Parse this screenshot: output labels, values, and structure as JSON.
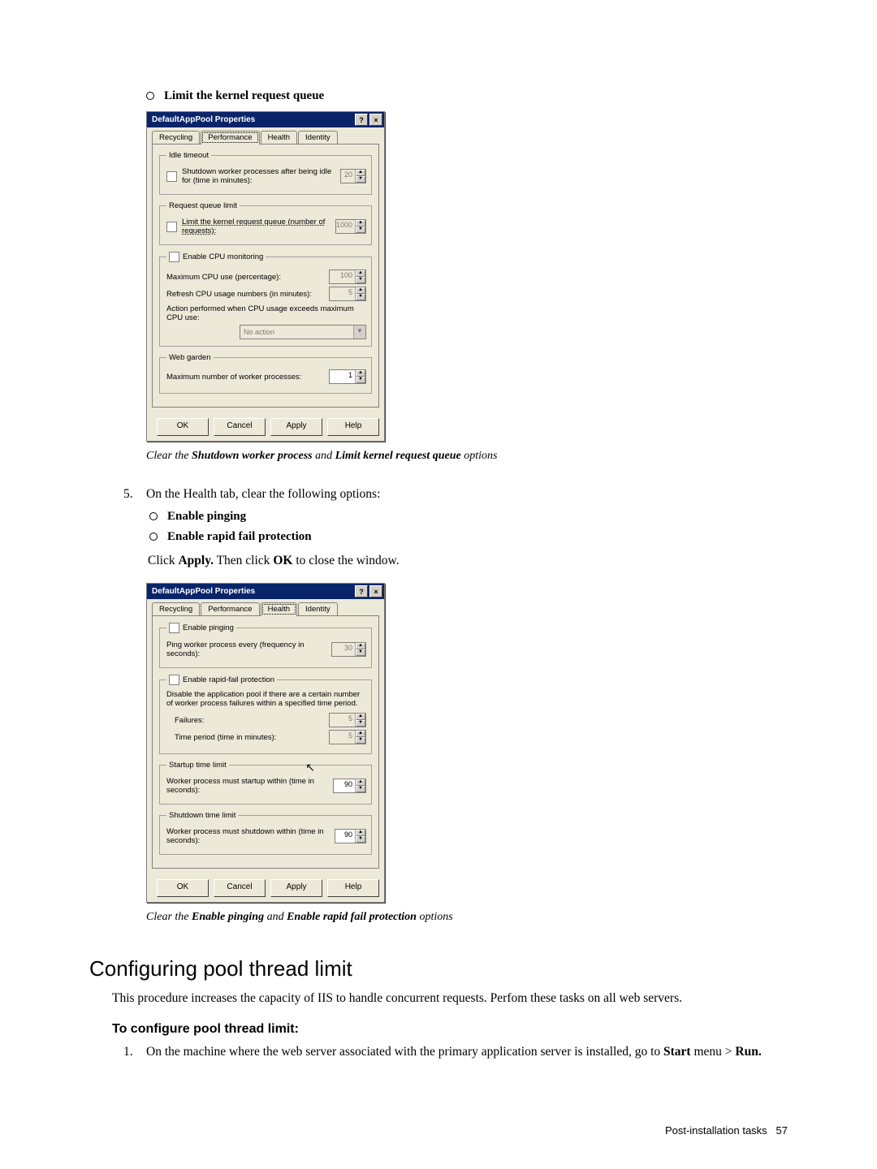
{
  "bullet_top": "Limit the kernel request queue",
  "dialog1": {
    "title": "DefaultAppPool Properties",
    "tabs": [
      "Recycling",
      "Performance",
      "Health",
      "Identity"
    ],
    "active_tab_index": 1,
    "idle": {
      "legend": "Idle timeout",
      "check_label": "Shutdown worker processes after being idle for (time in minutes):",
      "value": "20"
    },
    "queue": {
      "legend": "Request queue limit",
      "check_label": "Limit the kernel request queue (number of requests):",
      "value": "1000"
    },
    "cpu": {
      "legend": "Enable CPU monitoring",
      "max_label": "Maximum CPU use (percentage):",
      "max_value": "100",
      "refresh_label": "Refresh CPU usage numbers (in minutes):",
      "refresh_value": "5",
      "action_label": "Action performed when CPU usage exceeds maximum CPU use:",
      "action_value": "No action"
    },
    "garden": {
      "legend": "Web garden",
      "label": "Maximum number of worker processes:",
      "value": "1"
    },
    "buttons": [
      "OK",
      "Cancel",
      "Apply",
      "Help"
    ]
  },
  "caption1_pre": "Clear the ",
  "caption1_b1": "Shutdown worker process",
  "caption1_mid": " and ",
  "caption1_b2": "Limit kernel request queue",
  "caption1_post": " options",
  "step5_num": "5.",
  "step5_text": "On the Health tab, clear the following options:",
  "step5_b1": "Enable pinging",
  "step5_b2": "Enable rapid fail protection",
  "after_click_pre": "Click ",
  "after_click_apply": "Apply.",
  "after_click_mid": " Then click ",
  "after_click_ok": "OK",
  "after_click_post": " to close the window.",
  "dialog2": {
    "title": "DefaultAppPool Properties",
    "tabs": [
      "Recycling",
      "Performance",
      "Health",
      "Identity"
    ],
    "active_tab_index": 2,
    "ping": {
      "legend": "Enable pinging",
      "label": "Ping worker process every (frequency in seconds):",
      "value": "30"
    },
    "rapid": {
      "legend": "Enable rapid-fail protection",
      "desc": "Disable the application pool if there are a certain number of worker process failures within a specified time period.",
      "failures_label": "Failures:",
      "failures_value": "5",
      "period_label": "Time period (time in minutes):",
      "period_value": "5"
    },
    "startup": {
      "legend": "Startup time limit",
      "label": "Worker process must startup within (time in seconds):",
      "value": "90"
    },
    "shutdown": {
      "legend": "Shutdown time limit",
      "label": "Worker process must shutdown within (time in seconds):",
      "value": "90"
    },
    "buttons": [
      "OK",
      "Cancel",
      "Apply",
      "Help"
    ]
  },
  "caption2_pre": "Clear the ",
  "caption2_b1": "Enable pinging",
  "caption2_mid": " and ",
  "caption2_b2": "Enable rapid fail protection",
  "caption2_post": " options",
  "section_heading": "Configuring pool thread limit",
  "section_body": "This procedure increases the capacity of IIS to handle concurrent requests. Perfom these tasks on all web servers.",
  "sub_heading": "To configure pool thread limit:",
  "step1_num": "1.",
  "step1_a": "On the machine where the web server associated with the primary application server is installed, go to ",
  "step1_b": "Start",
  "step1_c": " menu > ",
  "step1_d": "Run.",
  "footer_label": "Post-installation tasks",
  "footer_page": "57"
}
